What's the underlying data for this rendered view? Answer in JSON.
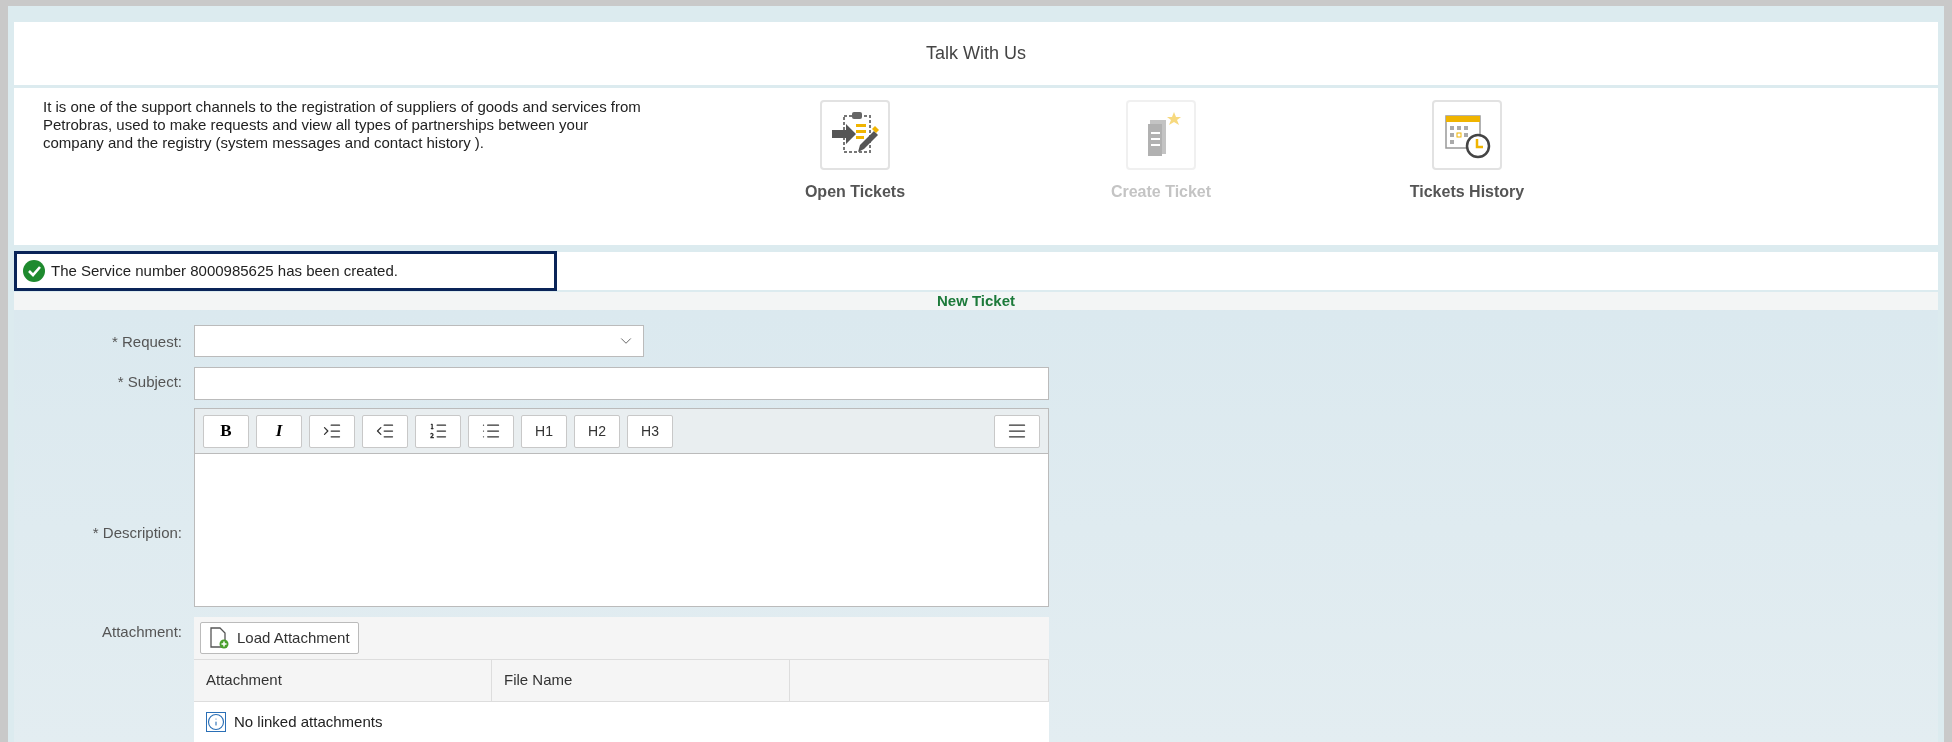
{
  "header": {
    "title": "Talk With Us"
  },
  "intro": "It is one of the support channels to the registration of suppliers of goods and services from Petrobras, used to make requests and view all types of partnerships between your company and the registry (system messages and contact history ).",
  "tiles": [
    {
      "kind": "open",
      "label": "Open Tickets",
      "disabled": false
    },
    {
      "kind": "create",
      "label": "Create Ticket",
      "disabled": true
    },
    {
      "kind": "history",
      "label": "Tickets History",
      "disabled": false
    }
  ],
  "message": {
    "kind": "success",
    "text": "The Service number 8000985625 has been created."
  },
  "form": {
    "title": "New Ticket",
    "request": {
      "label": "* Request:"
    },
    "subject": {
      "label": "* Subject:"
    },
    "description": {
      "label": "* Description:"
    },
    "toolbar": [
      {
        "kind": "bold",
        "text": "B"
      },
      {
        "kind": "italic",
        "text": "I"
      },
      {
        "kind": "indent"
      },
      {
        "kind": "outdent"
      },
      {
        "kind": "ordered"
      },
      {
        "kind": "bullets"
      },
      {
        "kind": "heading",
        "text": "H1"
      },
      {
        "kind": "heading",
        "text": "H2"
      },
      {
        "kind": "heading",
        "text": "H3"
      }
    ],
    "attachment": {
      "label": "Attachment:",
      "button": "Load Attachment",
      "columns": [
        "Attachment",
        "File Name"
      ],
      "empty": "No linked attachments"
    }
  }
}
